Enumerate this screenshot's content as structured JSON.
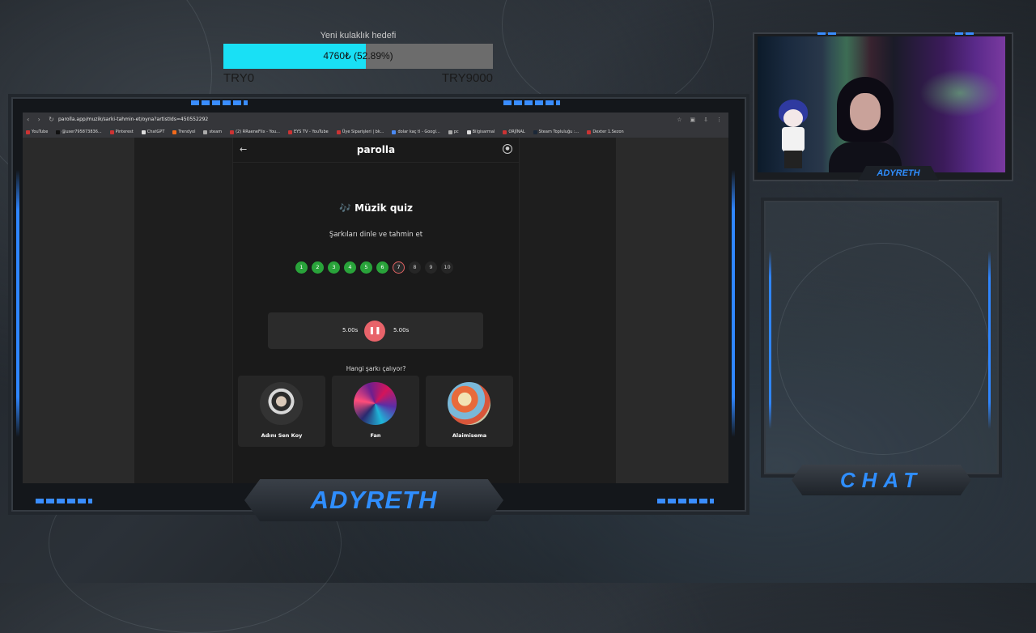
{
  "goal": {
    "title": "Yeni kulaklık hedefi",
    "progress_text": "4760₺ (52.89%)",
    "progress_fraction": 0.5289,
    "min_label": "TRY0",
    "max_label": "TRY9000"
  },
  "browser": {
    "url": "parolla.app/muzik/sarki-tahmin-et/oyna?artistIds=450552292",
    "bookmarks": [
      "YouTube",
      "@user795873836...",
      "Pinterest",
      "ChatGPT",
      "Trendyol",
      "steam",
      "(2) RRaeneFlix - You...",
      "EYS TV - YouTube",
      "Üye Siparişleri | bk...",
      "dolar kaç tl - Googl...",
      "pc",
      "Bilgisarmal",
      "ORJİNAL",
      "Steam Topluluğu :...",
      "Dexter 1.Sezon"
    ]
  },
  "app": {
    "logo": "parolla",
    "quiz_title": "🎶 Müzik quiz",
    "subtitle": "Şarkıları dinle ve tahmin et",
    "steps": [
      {
        "label": "1",
        "state": "done"
      },
      {
        "label": "2",
        "state": "done"
      },
      {
        "label": "3",
        "state": "done"
      },
      {
        "label": "4",
        "state": "done"
      },
      {
        "label": "5",
        "state": "done"
      },
      {
        "label": "6",
        "state": "done"
      },
      {
        "label": "7",
        "state": "current"
      },
      {
        "label": "8",
        "state": "todo"
      },
      {
        "label": "9",
        "state": "todo"
      },
      {
        "label": "10",
        "state": "todo"
      }
    ],
    "player": {
      "elapsed": "5.00s",
      "total": "5.00s"
    },
    "question": "Hangi şarkı çalıyor?",
    "answers": [
      "Adını Sen Koy",
      "Fan",
      "Alaimisema"
    ]
  },
  "overlay": {
    "streamer_name": "ADYRETH",
    "cam_label": "ADYRETH",
    "chat_label": "CHAT"
  },
  "colors": {
    "accent_blue": "#2f8eff",
    "goal_fill": "#19e0f5",
    "step_done": "#29a33a",
    "play_button": "#e8636a"
  }
}
